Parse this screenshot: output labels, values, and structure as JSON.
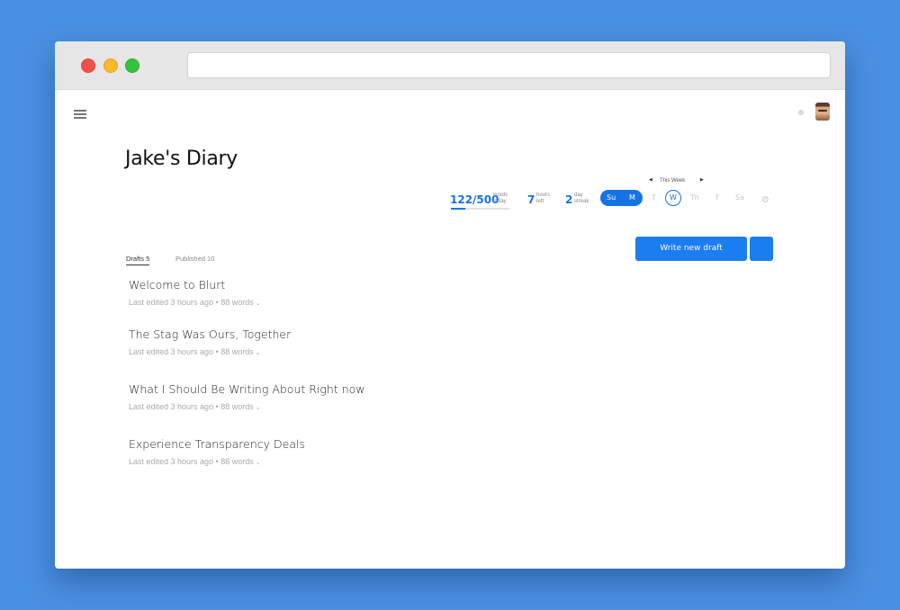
{
  "app": {
    "title": "Jake's Diary"
  },
  "stats": {
    "words_value": "122/500",
    "words_label_1": "words",
    "words_label_2": "today",
    "words_progress": 0.244,
    "hours_value": "7",
    "hours_label_1": "hours",
    "hours_label_2": "left",
    "streak_value": "2",
    "streak_label_1": "day",
    "streak_label_2": "streak"
  },
  "week": {
    "label": "This Week",
    "done_days": [
      "Su",
      "M"
    ],
    "days": [
      "T",
      "Th",
      "F",
      "Sa"
    ],
    "today": "W"
  },
  "actions": {
    "write_label": "Write new draft"
  },
  "tabs": [
    {
      "label": "Drafts 5",
      "active": true
    },
    {
      "label": "Published 10",
      "active": false
    }
  ],
  "drafts": [
    {
      "title": "Welcome to Blurt",
      "meta": "Last edited 3 hours ago • 88 words"
    },
    {
      "title": "The Stag Was Ours, Together",
      "meta": "Last edited 3 hours ago • 88 words"
    },
    {
      "title": "What I Should Be Writing About Right now",
      "meta": "Last edited 3 hours ago • 88 words"
    },
    {
      "title": "Experience Transparency Deals",
      "meta": "Last edited 3 hours ago • 88 words"
    }
  ],
  "colors": {
    "background": "#4a90e2",
    "accent": "#1573e6"
  }
}
